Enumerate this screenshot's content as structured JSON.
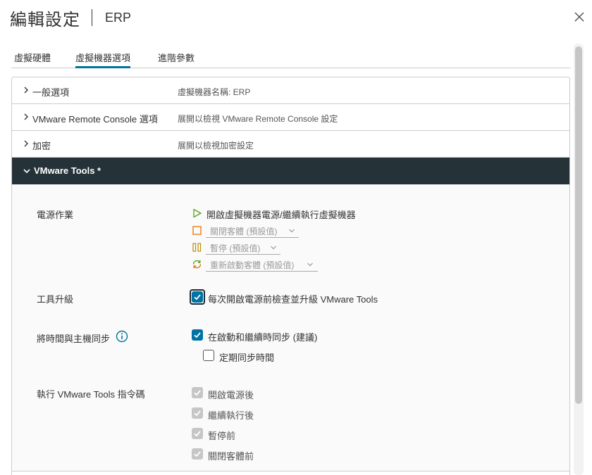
{
  "dialog": {
    "title": "編輯設定",
    "subtitle": "ERP"
  },
  "tabs": [
    {
      "label": "虛擬硬體",
      "active": false
    },
    {
      "label": "虛擬機器選項",
      "active": true
    },
    {
      "label": "進階參數",
      "active": false
    }
  ],
  "sections": {
    "general": {
      "label": "一般選項",
      "value": "虛擬機器名稱: ERP"
    },
    "vmrc": {
      "label": "VMware Remote Console 選項",
      "value": "展開以檢視 VMware Remote Console 設定"
    },
    "encryption": {
      "label": "加密",
      "value": "展開以檢視加密設定"
    },
    "tools": {
      "label": "VMware Tools *"
    }
  },
  "tools": {
    "power_ops": {
      "label": "電源作業",
      "power_on": "開啟虛擬機器電源/繼續執行虛擬機器",
      "shutdown": "關閉客體 (預設值)",
      "suspend": "暫停 (預設值)",
      "restart": "重新啟動客體 (預設值)"
    },
    "upgrade": {
      "label": "工具升級",
      "option": "每次開啟電源前檢查並升級 VMware Tools",
      "checked": true
    },
    "time_sync": {
      "label": "將時間與主機同步",
      "option1": "在啟動和繼續時同步 (建議)",
      "option1_checked": true,
      "option2": "定期同步時間",
      "option2_checked": false
    },
    "scripts": {
      "label": "執行 VMware Tools 指令碼",
      "items": [
        "開啟電源後",
        "繼續執行後",
        "暫停前",
        "關閉客體前"
      ]
    }
  },
  "colors": {
    "accent": "#0072a3",
    "header_dark": "#253238",
    "play_green": "#5aa220",
    "stop_orange": "#e57200",
    "pause_yellow": "#c28b00",
    "restart_green": "#5aa220",
    "restart_orange": "#e57200"
  },
  "icons": [
    "close-icon",
    "chevron-right-icon",
    "chevron-down-icon",
    "play-icon",
    "stop-icon",
    "pause-icon",
    "restart-icon",
    "info-icon",
    "check-icon"
  ]
}
